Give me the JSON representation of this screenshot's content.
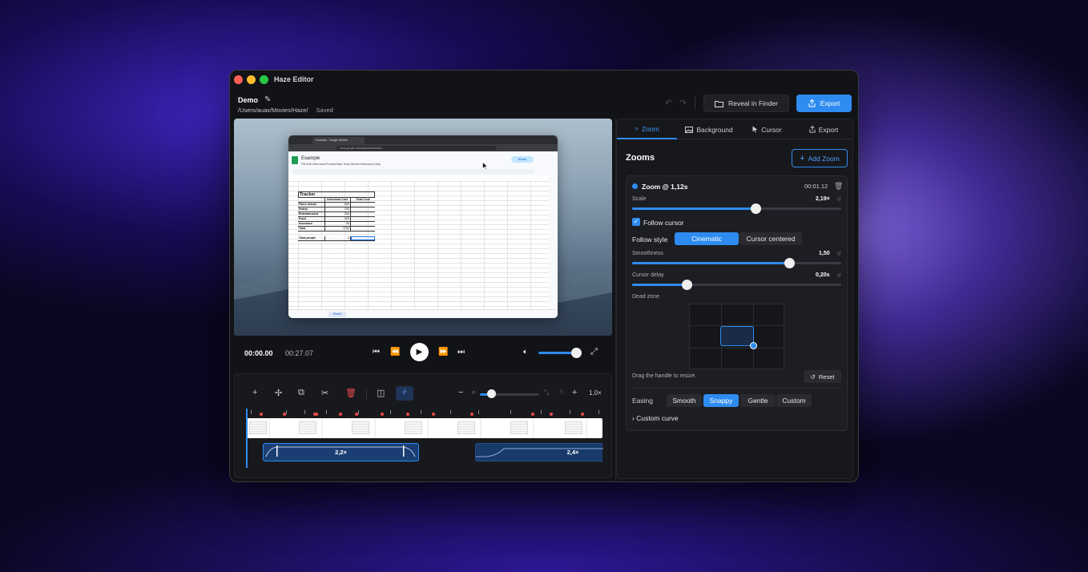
{
  "window": {
    "title": "Haze Editor"
  },
  "project": {
    "name": "Demo",
    "path": "/Users/auax/Movies/Haze/",
    "status": "Saved"
  },
  "header": {
    "reveal_label": "Reveal in Finder",
    "export_label": "Export"
  },
  "preview": {
    "browser_tab": "Example - Google Sheets",
    "url": "docs.google.com/spreadsheets/d/...",
    "sheet_name": "Example",
    "menu": "File  Edit  View  Insert  Format  Data  Tools  Gemini  Extensions  Help",
    "share": "Share",
    "sheet_tab": "Sheet1",
    "tracker_title": "Tracker",
    "tracker_headers": [
      "",
      "Individual Cost",
      "Total Cost"
    ],
    "tracker_rows": [
      [
        "Plane tickets",
        "500",
        ""
      ],
      [
        "Hotels",
        "700",
        ""
      ],
      [
        "Entertainment",
        "200",
        ""
      ],
      [
        "Food",
        "300",
        ""
      ],
      [
        "Insurance",
        "50",
        ""
      ],
      [
        "Total",
        "1750",
        ""
      ],
      [
        "",
        "",
        ""
      ],
      [
        "Total people",
        "3",
        ""
      ]
    ]
  },
  "playback": {
    "current_time": "00:00.00",
    "total_time": "00:27.07",
    "volume": 0.85
  },
  "timeline": {
    "zoom_value": "1,0×",
    "zoom_slider": 0.15,
    "clips": [
      {
        "label": "2,2×"
      },
      {
        "label": "2,4×"
      }
    ]
  },
  "panel": {
    "tabs": [
      {
        "label": "Zoom",
        "icon": "search-icon",
        "active": true
      },
      {
        "label": "Background",
        "icon": "image-icon",
        "active": false
      },
      {
        "label": "Cursor",
        "icon": "cursor-icon",
        "active": false
      },
      {
        "label": "Export",
        "icon": "share-icon",
        "active": false
      }
    ],
    "zooms_title": "Zooms",
    "add_zoom_label": "Add Zoom",
    "zoom": {
      "title": "Zoom @ 1,12s",
      "time": "00:01.12",
      "scale": {
        "label": "Scale",
        "value": "2,19×",
        "fraction": 0.59
      },
      "follow_cursor": {
        "label": "Follow cursor",
        "checked": true
      },
      "follow_style": {
        "label": "Follow style",
        "options": [
          "Cinematic",
          "Cursor centered"
        ],
        "selected": "Cinematic"
      },
      "smoothness": {
        "label": "Smoothness",
        "value": "1,50",
        "fraction": 0.75
      },
      "cursor_delay": {
        "label": "Cursor delay",
        "value": "0,20s",
        "fraction": 0.26
      },
      "dead_zone": {
        "label": "Dead zone",
        "hint": "Drag the handle to resize.",
        "reset_label": "Reset"
      },
      "easing": {
        "label": "Easing",
        "options": [
          "Smooth",
          "Snappy",
          "Gentle",
          "Custom"
        ],
        "selected": "Snappy"
      },
      "custom_curve_label": "Custom curve"
    }
  },
  "colors": {
    "accent": "#2e8cf0",
    "danger": "#e84a4a",
    "panel": "#17181c"
  }
}
